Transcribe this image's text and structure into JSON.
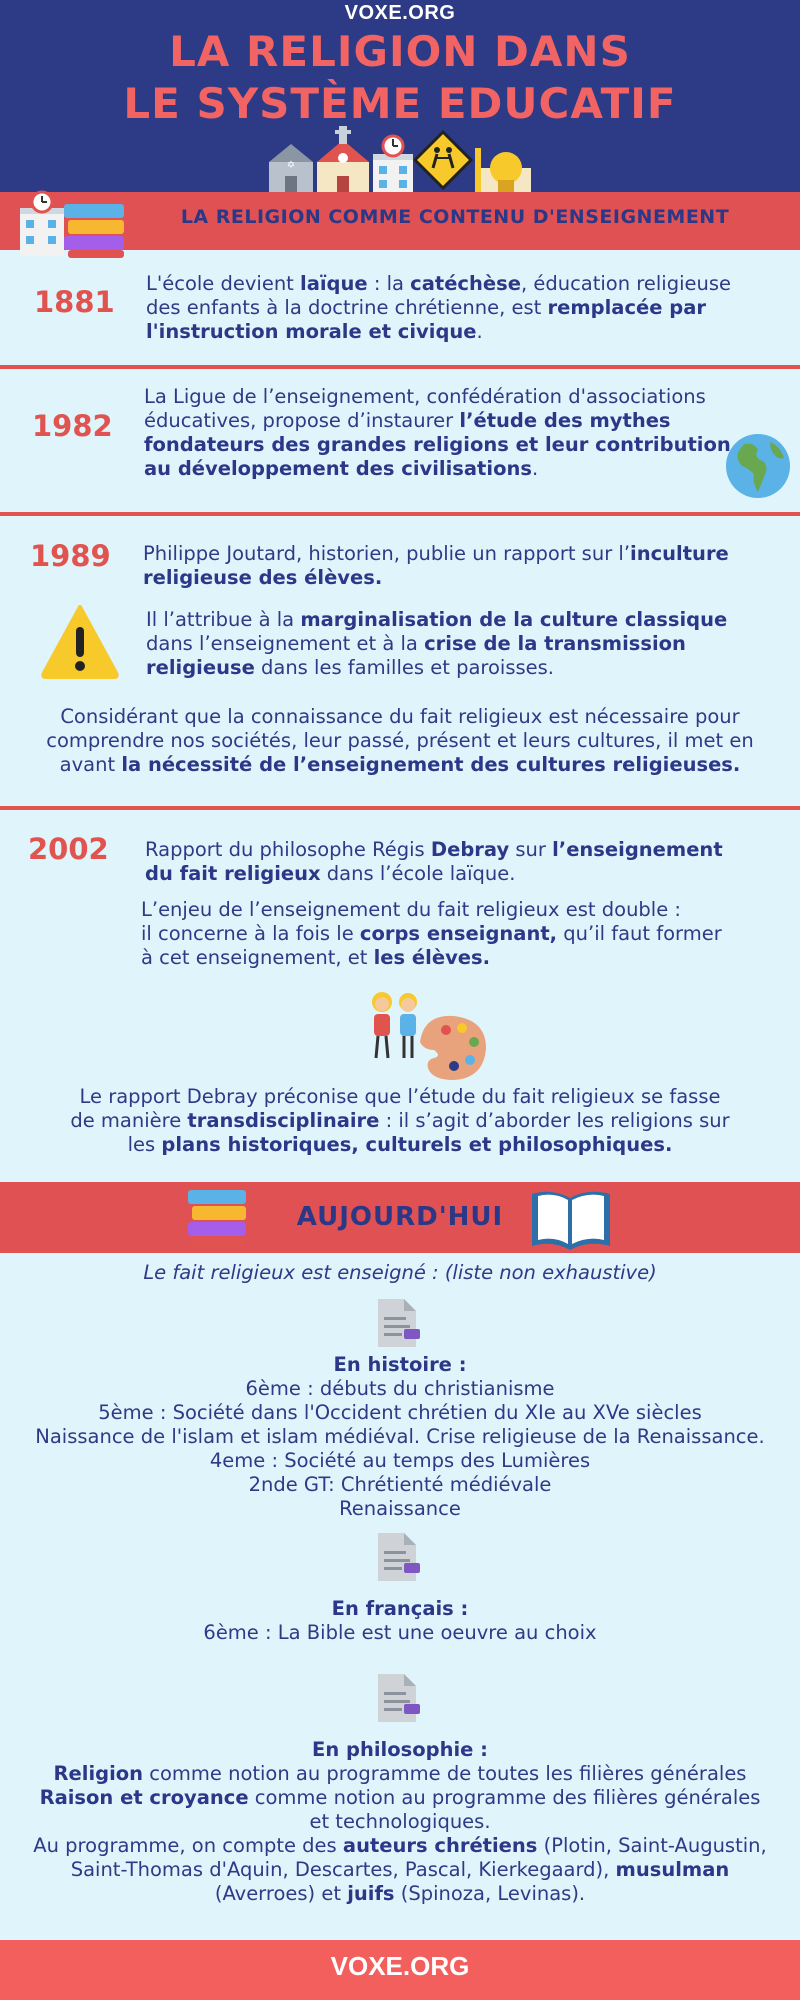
{
  "header": {
    "site": "VOXE.ORG",
    "title_line1": "LA RELIGION DANS",
    "title_line2": "LE SYSTÈME EDUCATIF"
  },
  "section1": {
    "title": "LA RELIGION COMME CONTENU D'ENSEIGNEMENT"
  },
  "y1881": {
    "year": "1881",
    "l1a": "L'école devient ",
    "l1b": "laïque",
    "l1c": " : la ",
    "l1d": "catéchèse",
    "l1e": ", éducation religieuse",
    "l2a": "des enfants à la doctrine chrétienne, est ",
    "l2b": "remplacée par",
    "l3a": "l'instruction morale et civique",
    "l3b": "."
  },
  "y1982": {
    "year": "1982",
    "l1": "La Ligue de l’enseignement, confédération d'associations",
    "l2a": "éducatives, propose d’instaurer ",
    "l2b": "l’étude des mythes",
    "l3": "fondateurs des grandes religions et leur contribution",
    "l4a": "au développement des civilisations",
    "l4b": "."
  },
  "y1989": {
    "year": "1989",
    "l1a": "Philippe Joutard, historien, publie un rapport sur l’",
    "l1b": "inculture",
    "l2": "religieuse des élèves.",
    "p2l1a": "Il l’attribue à la ",
    "p2l1b": "marginalisation de la culture classique",
    "p2l2a": "dans l’enseignement et à la ",
    "p2l2b": "crise de la transmission",
    "p2l3a": "religieuse",
    "p2l3b": " dans les familles et paroisses.",
    "c1": "Considérant que la connaissance du fait religieux est nécessaire pour",
    "c2": "comprendre nos sociétés, leur passé, présent et leurs cultures, il met en",
    "c3a": "avant ",
    "c3b": "la nécessité de l’enseignement des cultures religieuses."
  },
  "y2002": {
    "year": "2002",
    "l1a": "Rapport du philosophe Régis ",
    "l1b": "Debray",
    "l1c": " sur ",
    "l1d": "l’enseignement",
    "l2a": "du fait religieux",
    "l2b": " dans l’école laïque.",
    "p2l1": "L’enjeu de l’enseignement du fait religieux est double :",
    "p2l2a": "il concerne à la fois le ",
    "p2l2b": "corps enseignant,",
    "p2l2c": " qu’il faut former",
    "p2l3a": "à cet enseignement, et ",
    "p2l3b": "les élèves.",
    "c1": "Le rapport Debray préconise que l’étude du fait religieux se fasse",
    "c2a": "de manière ",
    "c2b": "transdisciplinaire",
    "c2c": " : il s’agit d’aborder les religions sur",
    "c3a": "les ",
    "c3b": "plans historiques, culturels et philosophiques."
  },
  "section2": {
    "title": "AUJOURD'HUI"
  },
  "today": {
    "intro": "Le fait religieux est enseigné : (liste non exhaustive)",
    "hist_title": "En histoire :",
    "hist": [
      "6ème : débuts du christianisme",
      "5ème : Société dans l'Occident chrétien du XIe au XVe siècles",
      "Naissance de l'islam et islam médiéval. Crise religieuse de la Renaissance.",
      "4eme : Société au temps des Lumières",
      "2nde GT: Chrétienté médiévale",
      "Renaissance"
    ],
    "fr_title": "En français :",
    "fr": "6ème : La Bible est une oeuvre au choix",
    "philo_title": "En philosophie :",
    "p1a": "Religion",
    "p1b": " comme notion au programme de toutes les filières générales",
    "p2a": "Raison et croyance",
    "p2b": " comme notion au programme des filières générales",
    "p3": "et technologiques.",
    "p4a": "Au programme, on compte des ",
    "p4b": "auteurs chrétiens",
    "p4c": " (Plotin, Saint-Augustin,",
    "p5a": "Saint-Thomas d'Aquin, Descartes, Pascal, Kierkegaard), ",
    "p5b": "musulman",
    "p6a": "(Averroes) et ",
    "p6b": "juifs",
    "p6c": " (Spinoza, Levinas)."
  },
  "footer": {
    "site": "VOXE.ORG"
  }
}
